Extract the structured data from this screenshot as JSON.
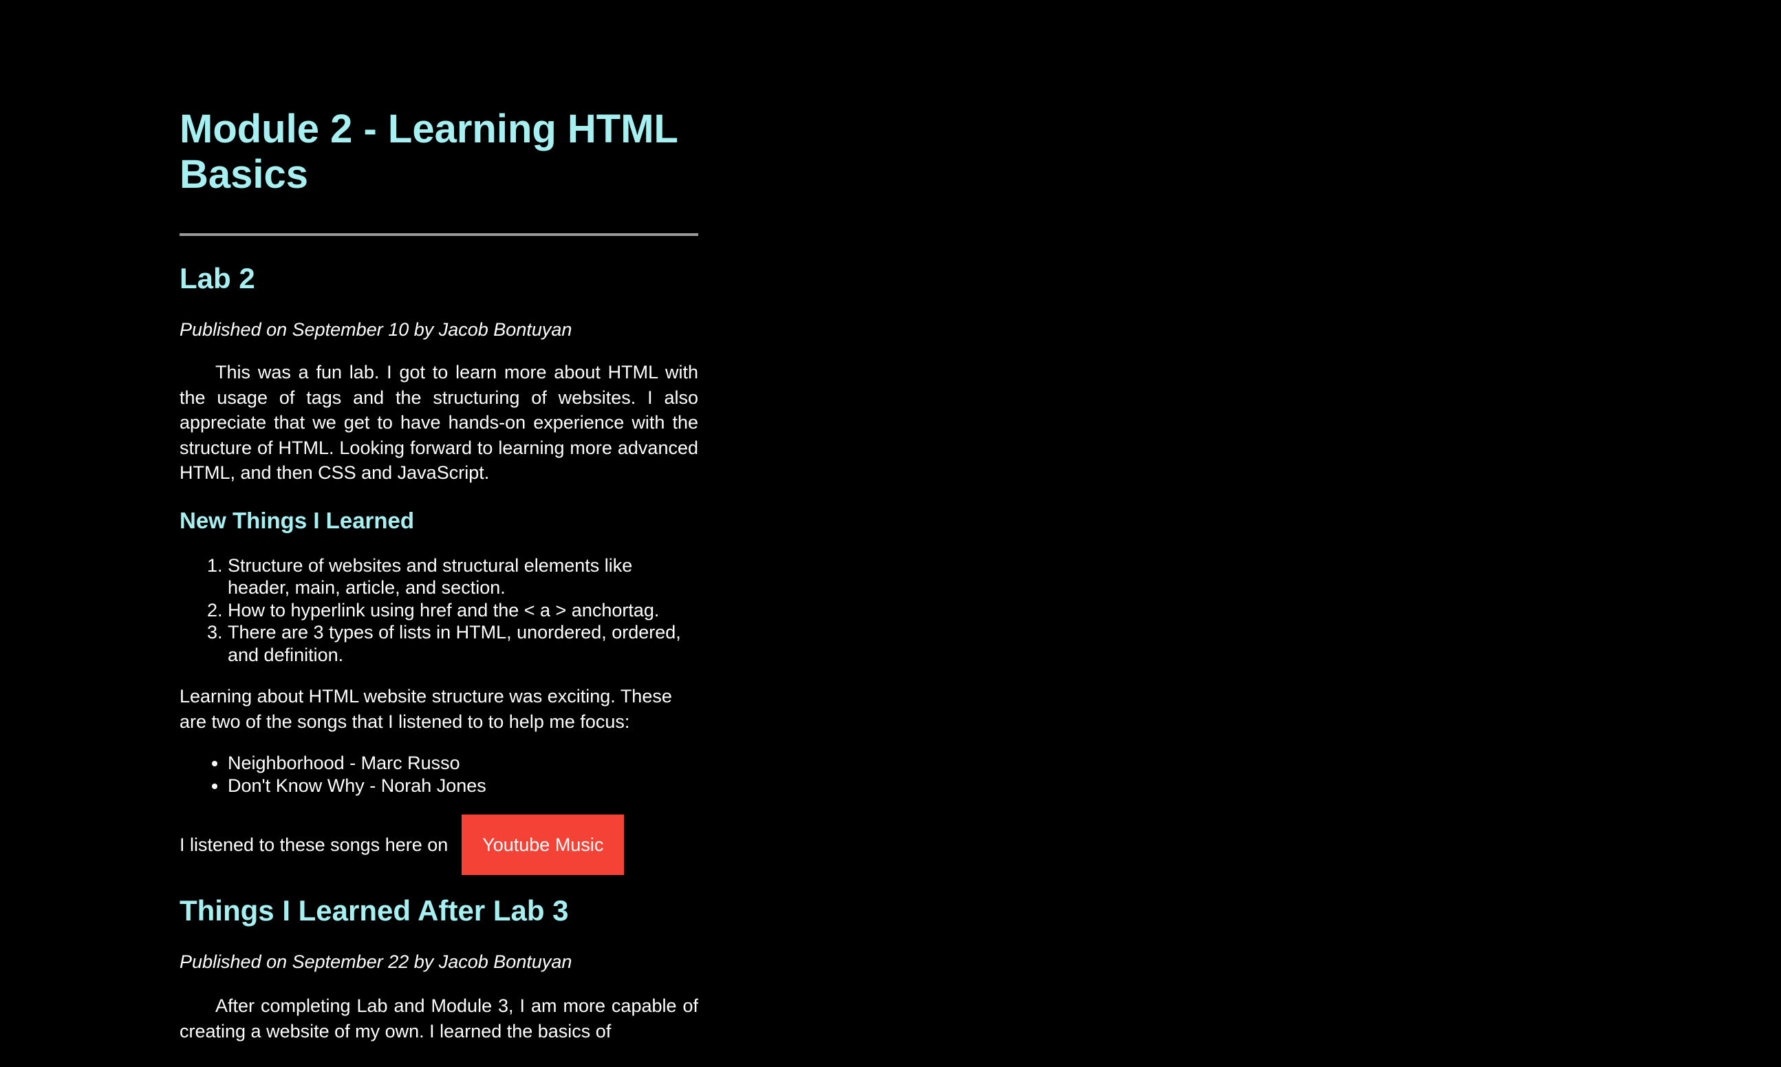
{
  "page": {
    "title": "Module 2 - Learning HTML Basics"
  },
  "lab2": {
    "heading": "Lab 2",
    "byline": "Published on September 10 by Jacob Bontuyan",
    "paragraph": "This was a fun lab. I got to learn more about HTML with the usage of tags and the structuring of websites. I also appreciate that we get to have hands-on experience with the structure of HTML. Looking forward to learning more advanced HTML, and then CSS and JavaScript.",
    "subheading": "New Things I Learned",
    "learned": [
      "Structure of websites and structural elements like header, main, article, and section.",
      "How to hyperlink using href and the < a > anchortag.",
      "There are 3 types of lists in HTML, unordered, ordered, and definition."
    ],
    "songs_intro": "Learning about HTML website structure was exciting. These are two of the songs that I listened to to help me focus:",
    "songs": [
      "Neighborhood - Marc Russo",
      "Don't Know Why - Norah Jones"
    ],
    "listen_text": "I listened to these songs here on",
    "listen_button": "Youtube Music"
  },
  "lab3": {
    "heading": "Things I Learned After Lab 3",
    "byline": "Published on September 22 by Jacob Bontuyan",
    "paragraph": "After completing Lab and Module 3, I am more capable of creating a website of my own. I learned the basics of"
  },
  "colors": {
    "background": "#000000",
    "heading": "#a6f0f2",
    "text": "#ffffff",
    "rule": "#9a9a9a",
    "button": "#f44336"
  }
}
